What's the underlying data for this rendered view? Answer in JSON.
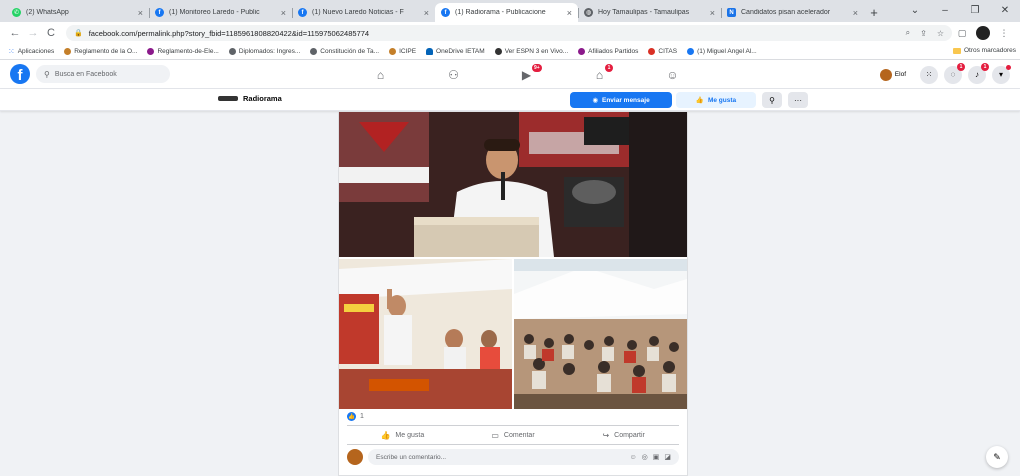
{
  "browser": {
    "tabs": [
      {
        "label": "(2) WhatsApp",
        "icon": "whatsapp-icon",
        "color": "#25d366",
        "active": false
      },
      {
        "label": "(1) Monitoreo Laredo - Public",
        "icon": "facebook-icon",
        "color": "#1877f2",
        "active": false
      },
      {
        "label": "(1) Nuevo Laredo Noticias - F",
        "icon": "facebook-icon",
        "color": "#1877f2",
        "active": false
      },
      {
        "label": "(1) Radiorama - Publicacione",
        "icon": "facebook-icon",
        "color": "#1877f2",
        "active": true
      },
      {
        "label": "Hoy Tamaulipas - Tamaulipas",
        "icon": "globe-icon",
        "color": "#5f6368",
        "active": false
      },
      {
        "label": "Candidatos pisan acelerador",
        "icon": "news-icon",
        "color": "#1a73e8",
        "active": false
      }
    ],
    "url": "facebook.com/permalink.php?story_fbid=1185961808820422&id=115975062485774",
    "bookmarks": [
      {
        "label": "Aplicaciones",
        "color": "#4285f4"
      },
      {
        "label": "Reglamento de la O...",
        "color": "#c47f2a"
      },
      {
        "label": "Reglamento-de-Ele...",
        "color": "#8b1a8b"
      },
      {
        "label": "Diplomados: Ingres...",
        "color": "#5f6368"
      },
      {
        "label": "Constitución de Ta...",
        "color": "#5f6368"
      },
      {
        "label": "ICIPE",
        "color": "#c47f2a"
      },
      {
        "label": "OneDrive IETAM",
        "color": "#0364b8"
      },
      {
        "label": "Ver ESPN 3 en Vivo...",
        "color": "#333333"
      },
      {
        "label": "Afiliados Partidos",
        "color": "#8b1a8b"
      },
      {
        "label": "CITAS",
        "color": "#d93025"
      },
      {
        "label": "(1) Miguel Angel Al...",
        "color": "#1877f2"
      }
    ],
    "other_bookmarks": "Otros marcadores"
  },
  "facebook": {
    "search_placeholder": "Busca en Facebook",
    "user_name": "Elof",
    "badges": {
      "watch": "9+",
      "marketplace": "1",
      "messenger": "1",
      "notifications": "1"
    }
  },
  "page": {
    "name": "Radiorama",
    "send_message": "Enviar mensaje",
    "like": "Me gusta"
  },
  "post": {
    "reaction_count": "1",
    "actions": {
      "like": "Me gusta",
      "comment": "Comentar",
      "share": "Compartir"
    },
    "comment_placeholder": "Escribe un comentario..."
  },
  "colors": {
    "fb_blue": "#1877f2",
    "badge_red": "#e41e3f"
  }
}
